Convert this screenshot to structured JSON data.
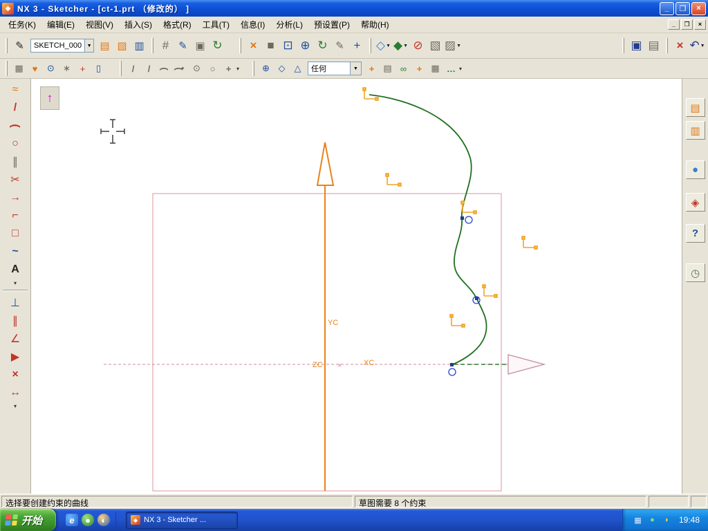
{
  "title_bar": {
    "title": "NX 3 - Sketcher - [ct-1.prt （修改的） ]"
  },
  "window_controls": {
    "minimize": "_",
    "restore": "❐",
    "close": "×"
  },
  "mdi_controls": {
    "minimize": "_",
    "restore": "❐",
    "close": "×"
  },
  "menu_bar": {
    "items": [
      "任务(K)",
      "编辑(E)",
      "视图(V)",
      "插入(S)",
      "格式(R)",
      "工具(T)",
      "信息(I)",
      "分析(L)",
      "预设置(P)",
      "帮助(H)"
    ]
  },
  "toolbar_sketch": {
    "sketch_name": "SKETCH_000"
  },
  "toolbar_snap": {
    "selected": "任何"
  },
  "icons": {
    "app": "◆",
    "dropdown": "▼",
    "sketch": "✎",
    "update": "▤",
    "notebook": "▧",
    "drum": "▥",
    "grid": "#",
    "annotate": "✎",
    "copy": "▣",
    "cycle": "↻",
    "finish": "×",
    "shade": "■",
    "zoom_window": "⊡",
    "zoom_inout": "⊕",
    "refresh": "↻",
    "edit_sheet": "✎",
    "pan": "+",
    "cube_wire": "◇",
    "cube_shaded": "◆",
    "no_entry": "⊘",
    "cube_gray": "▧",
    "cube_face": "▨",
    "save": "▣",
    "print": "▤",
    "delete": "×",
    "undo": "↶",
    "profile_grid": "▦",
    "favorite": "♥",
    "find": "⊙",
    "wand": "∗",
    "point_plus": "+",
    "jar": "▯",
    "line": "/",
    "line2": "/",
    "arc": "(",
    "arc3": "(",
    "circle_dot": "⊙",
    "circle": "○",
    "plus": "+",
    "snap_point": "⊕",
    "snap_end": "◇",
    "snap_mid": "△",
    "pin": "+",
    "layers": "▤",
    "chain": "∞",
    "plus_org": "+",
    "grid2": "▦",
    "dots": "…",
    "lt_profile": "≈",
    "lt_line": "/",
    "lt_arc": "(",
    "lt_circle": "○",
    "lt_derived": "∥",
    "lt_trim": "✂",
    "lt_extend": "→",
    "lt_fillet": "⌐",
    "lt_rect": "□",
    "lt_spline": "~",
    "lt_text": "A",
    "lt_more": "▾",
    "lt_constraint": "⊥",
    "lt_auto_constraint": "∥",
    "lt_show_constraint": "∠",
    "lt_animate": "▶",
    "lt_remove_constraint": "×",
    "lt_dimension": "↔",
    "rt_assembly_nav": "▤",
    "rt_part_nav": "▥",
    "rt_web": "●",
    "rt_roles": "◈",
    "rt_help": "?",
    "rt_history": "◷",
    "orient_arrow": "↑",
    "ql_ie": "e",
    "ql_msg": "●",
    "ql_browser": "◐",
    "tray_keyboard": "▦",
    "tray_green": "●",
    "tray_vol": "◗",
    "task_icon": "◆"
  },
  "canvas": {
    "axis_y_label": "YC",
    "axis_x_label": "XC",
    "origin_label": "ZC",
    "origin_mark": "×"
  },
  "status_bar": {
    "prompt": "选择要创建约束的曲线",
    "hint": "草图需要 8 个约束"
  },
  "taskbar": {
    "start": "开始",
    "task": "NX 3 - Sketcher ...",
    "clock": "19:48"
  }
}
